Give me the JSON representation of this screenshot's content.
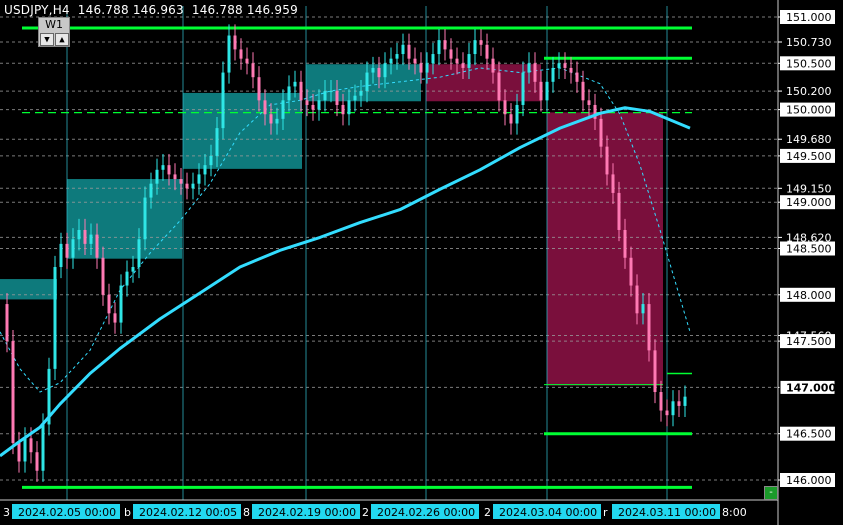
{
  "header": {
    "symbol": "USDJPY,H4",
    "open": "146.788",
    "high": "146.963",
    "low": "146.788",
    "close": "146.959"
  },
  "timeframe": {
    "label": "W1",
    "down": "▼",
    "up": "▲"
  },
  "corner_button": "-",
  "colors": {
    "background": "#000000",
    "bull_candle": "#2fe6e6",
    "bear_candle": "#ff7ab4",
    "zone_bull": "#0e7a7c",
    "zone_bear": "#7a0f3c",
    "level_line": "#00ff33",
    "ma_main": "#33ddff",
    "grid": "#9a9a9a",
    "vertical": "#2fb8c8",
    "price_label_bg": "#ffffff",
    "current_price_bg": "#ffffff",
    "date_label_bg": "#22d8f0"
  },
  "chart_data": {
    "type": "candlestick",
    "title": "",
    "y_axis_labels": [
      "151.000",
      "150.730",
      "150.500",
      "150.200",
      "150.000",
      "149.680",
      "149.500",
      "149.150",
      "149.000",
      "148.620",
      "148.500",
      "148.000",
      "147.560",
      "147.500",
      "147.000",
      "146.500",
      "146.000"
    ],
    "highlighted_y_labels": [
      "151.000",
      "150.500",
      "150.000",
      "149.500",
      "149.000",
      "148.500",
      "148.000",
      "147.500",
      "147.000",
      "146.500",
      "146.000"
    ],
    "ylim": [
      145.92,
      151.12
    ],
    "x_axis_labels": [
      "2024.02.05 00:00",
      "2024.02.12 00:05",
      "2024.02.19 00:00",
      "2024.02.26 00:00",
      "2024.03.04 00:00",
      "2024.03.11 00:00"
    ],
    "current_price": "147.000",
    "key_levels": [
      151.0,
      150.5,
      150.0,
      146.5,
      145.92
    ],
    "moving_average_main": [
      [
        0,
        146.26
      ],
      [
        20,
        146.42
      ],
      [
        40,
        146.57
      ],
      [
        60,
        146.82
      ],
      [
        90,
        147.15
      ],
      [
        120,
        147.42
      ],
      [
        160,
        147.74
      ],
      [
        200,
        148.02
      ],
      [
        240,
        148.3
      ],
      [
        280,
        148.48
      ],
      [
        320,
        148.62
      ],
      [
        360,
        148.78
      ],
      [
        400,
        148.92
      ],
      [
        440,
        149.14
      ],
      [
        480,
        149.35
      ],
      [
        520,
        149.59
      ],
      [
        560,
        149.8
      ],
      [
        600,
        149.96
      ],
      [
        625,
        150.02
      ],
      [
        650,
        149.98
      ],
      [
        690,
        149.8
      ]
    ],
    "moving_average_fast": [
      [
        0,
        147.6
      ],
      [
        20,
        147.2
      ],
      [
        40,
        146.95
      ],
      [
        60,
        147.05
      ],
      [
        90,
        147.4
      ],
      [
        120,
        148.05
      ],
      [
        150,
        148.45
      ],
      [
        180,
        148.8
      ],
      [
        210,
        149.2
      ],
      [
        240,
        149.75
      ],
      [
        270,
        150.05
      ],
      [
        300,
        150.1
      ],
      [
        330,
        150.2
      ],
      [
        360,
        150.25
      ],
      [
        400,
        150.3
      ],
      [
        440,
        150.35
      ],
      [
        480,
        150.45
      ],
      [
        520,
        150.4
      ],
      [
        560,
        150.45
      ],
      [
        600,
        150.28
      ],
      [
        620,
        149.95
      ],
      [
        640,
        149.4
      ],
      [
        660,
        148.7
      ],
      [
        675,
        148.15
      ],
      [
        690,
        147.6
      ]
    ],
    "zones": [
      {
        "kind": "bull",
        "x0": 0,
        "x1": 57,
        "top": 148.17,
        "bottom": 147.95
      },
      {
        "kind": "bull",
        "x0": 67,
        "x1": 182,
        "top": 149.25,
        "bottom": 148.39
      },
      {
        "kind": "bull",
        "x0": 183,
        "x1": 302,
        "top": 150.18,
        "bottom": 149.36
      },
      {
        "kind": "bull",
        "x0": 306,
        "x1": 421,
        "top": 150.49,
        "bottom": 150.09
      },
      {
        "kind": "bear",
        "x0": 426,
        "x1": 541,
        "top": 150.49,
        "bottom": 150.09
      },
      {
        "kind": "bear",
        "x0": 547,
        "x1": 663,
        "top": 149.97,
        "bottom": 147.02
      }
    ],
    "candles_low_detail": {
      "note": "candles drawn as a stylised price path",
      "path": [
        [
          4,
          147.9
        ],
        [
          10,
          147.5
        ],
        [
          16,
          146.4
        ],
        [
          22,
          146.2
        ],
        [
          28,
          146.45
        ],
        [
          34,
          146.3
        ],
        [
          40,
          146.1
        ],
        [
          46,
          146.6
        ],
        [
          52,
          147.2
        ],
        [
          58,
          148.3
        ],
        [
          64,
          148.55
        ],
        [
          70,
          148.4
        ],
        [
          76,
          148.6
        ],
        [
          82,
          148.7
        ],
        [
          88,
          148.55
        ],
        [
          94,
          148.65
        ],
        [
          100,
          148.4
        ],
        [
          106,
          148.0
        ],
        [
          112,
          147.8
        ],
        [
          118,
          147.7
        ],
        [
          124,
          148.1
        ],
        [
          130,
          148.25
        ],
        [
          136,
          148.3
        ],
        [
          142,
          148.6
        ],
        [
          148,
          149.05
        ],
        [
          154,
          149.2
        ],
        [
          160,
          149.35
        ],
        [
          166,
          149.4
        ],
        [
          172,
          149.3
        ],
        [
          178,
          149.25
        ],
        [
          184,
          149.2
        ],
        [
          190,
          149.15
        ],
        [
          196,
          149.2
        ],
        [
          202,
          149.3
        ],
        [
          208,
          149.4
        ],
        [
          214,
          149.5
        ],
        [
          220,
          149.8
        ],
        [
          226,
          150.4
        ],
        [
          232,
          150.8
        ],
        [
          238,
          150.65
        ],
        [
          244,
          150.55
        ],
        [
          250,
          150.5
        ],
        [
          256,
          150.35
        ],
        [
          262,
          150.1
        ],
        [
          268,
          149.95
        ],
        [
          274,
          149.85
        ],
        [
          280,
          149.9
        ],
        [
          286,
          150.1
        ],
        [
          292,
          150.25
        ],
        [
          298,
          150.3
        ],
        [
          304,
          150.1
        ],
        [
          310,
          150.05
        ],
        [
          316,
          150.0
        ],
        [
          322,
          150.1
        ],
        [
          328,
          150.2
        ],
        [
          334,
          150.2
        ],
        [
          340,
          150.05
        ],
        [
          346,
          149.95
        ],
        [
          352,
          150.1
        ],
        [
          358,
          150.15
        ],
        [
          364,
          150.2
        ],
        [
          370,
          150.4
        ],
        [
          376,
          150.45
        ],
        [
          382,
          150.35
        ],
        [
          388,
          150.5
        ],
        [
          394,
          150.55
        ],
        [
          400,
          150.6
        ],
        [
          406,
          150.7
        ],
        [
          412,
          150.55
        ],
        [
          418,
          150.5
        ],
        [
          424,
          150.4
        ],
        [
          430,
          150.5
        ],
        [
          436,
          150.6
        ],
        [
          442,
          150.75
        ],
        [
          448,
          150.65
        ],
        [
          454,
          150.55
        ],
        [
          460,
          150.5
        ],
        [
          466,
          150.45
        ],
        [
          472,
          150.6
        ],
        [
          478,
          150.75
        ],
        [
          484,
          150.7
        ],
        [
          490,
          150.55
        ],
        [
          496,
          150.4
        ],
        [
          502,
          150.1
        ],
        [
          508,
          149.95
        ],
        [
          514,
          149.85
        ],
        [
          520,
          150.05
        ],
        [
          526,
          150.4
        ],
        [
          532,
          150.5
        ],
        [
          538,
          150.3
        ],
        [
          544,
          150.1
        ],
        [
          550,
          150.3
        ],
        [
          556,
          150.45
        ],
        [
          562,
          150.5
        ],
        [
          568,
          150.45
        ],
        [
          574,
          150.4
        ],
        [
          580,
          150.3
        ],
        [
          586,
          150.1
        ],
        [
          592,
          150.05
        ],
        [
          598,
          149.9
        ],
        [
          604,
          149.6
        ],
        [
          610,
          149.3
        ],
        [
          616,
          149.1
        ],
        [
          622,
          148.7
        ],
        [
          628,
          148.4
        ],
        [
          634,
          148.1
        ],
        [
          640,
          147.8
        ],
        [
          646,
          147.9
        ],
        [
          652,
          147.4
        ],
        [
          658,
          146.95
        ],
        [
          664,
          146.75
        ],
        [
          670,
          146.7
        ],
        [
          676,
          146.85
        ],
        [
          682,
          146.8
        ],
        [
          688,
          146.9
        ]
      ]
    },
    "grid": true,
    "legend": "none"
  }
}
